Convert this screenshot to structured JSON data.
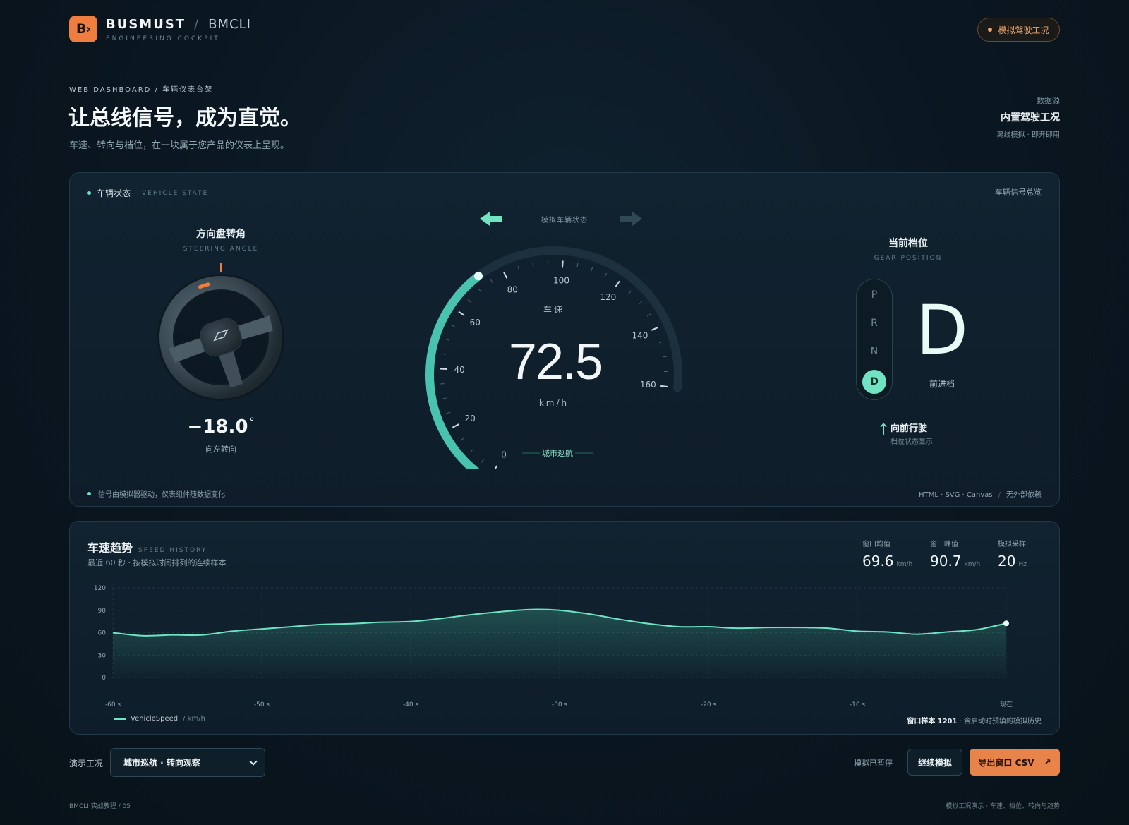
{
  "brand": {
    "logo": "B›",
    "name": "BUSMUST",
    "separator": "/",
    "product": "BMCLI",
    "tagline": "ENGINEERING COCKPIT"
  },
  "status_pill": "模拟驾驶工况",
  "hero": {
    "crumb": "WEB DASHBOARD / 车辆仪表台架",
    "title": "让总线信号，成为直觉。",
    "subtitle": "车速、转向与档位，在一块属于您产品的仪表上呈现。"
  },
  "source": {
    "label": "数据源",
    "value": "内置驾驶工况",
    "note": "离线模拟 · 即开即用"
  },
  "vehicle_panel": {
    "title": "车辆状态",
    "title_en": "VEHICLE STATE",
    "overview": "车辆信号总览",
    "turn_label": "模拟车辆状态",
    "footer_left": "信号由模拟器驱动，仪表组件随数据变化",
    "footer_tech": "HTML · SVG · Canvas",
    "footer_sep": "/",
    "footer_deps": "无外部依赖"
  },
  "steering": {
    "title": "方向盘转角",
    "title_en": "STEERING ANGLE",
    "value": "−18.0",
    "unit": "°",
    "direction": "向左转向",
    "angle": -18
  },
  "speedometer": {
    "label": "车速",
    "value": "72.5",
    "unit": "km/h",
    "mode": "城市巡航",
    "speed": 72.5,
    "max": 160,
    "ticks": [
      "0",
      "20",
      "40",
      "60",
      "80",
      "100",
      "120",
      "140",
      "160"
    ],
    "accent": "#6fe3c2"
  },
  "gear": {
    "title": "当前档位",
    "title_en": "GEAR POSITION",
    "options": [
      "P",
      "R",
      "N",
      "D"
    ],
    "selected": "D",
    "selected_label": "前进档",
    "direction_title": "向前行驶",
    "direction_sub": "档位状态显示"
  },
  "trend": {
    "title": "车速趋势",
    "title_en": "SPEED HISTORY",
    "subtitle": "最近 60 秒 · 按模拟时间排列的连续样本",
    "stats": [
      {
        "label": "窗口均值",
        "value": "69.6",
        "unit": "km/h"
      },
      {
        "label": "窗口峰值",
        "value": "90.7",
        "unit": "km/h"
      },
      {
        "label": "模拟采样",
        "value": "20",
        "unit": "Hz"
      }
    ],
    "legend_name": "VehicleSpeed",
    "legend_unit": "/ km/h",
    "window_note_label": "窗口样本",
    "window_note_count": "1201",
    "window_note_rest": "· 含启动时预填的模拟历史"
  },
  "chart_data": {
    "type": "area",
    "xlabel": "",
    "ylabel": "",
    "x_tick_labels": [
      "-60 s",
      "-50 s",
      "-40 s",
      "-30 s",
      "-20 s",
      "-10 s",
      "现在"
    ],
    "y_tick_labels": [
      "0",
      "30",
      "60",
      "90",
      "120"
    ],
    "ylim": [
      0,
      120
    ],
    "xlim": [
      -60,
      0
    ],
    "grid": true,
    "series": [
      {
        "name": "VehicleSpeed",
        "x": [
          -60,
          -58,
          -56,
          -54,
          -52,
          -50,
          -48,
          -46,
          -44,
          -42,
          -40,
          -38,
          -36,
          -34,
          -32,
          -30,
          -28,
          -26,
          -24,
          -22,
          -20,
          -18,
          -16,
          -14,
          -12,
          -10,
          -8,
          -6,
          -4,
          -2,
          0
        ],
        "values": [
          60,
          56,
          57,
          57,
          62,
          65,
          68,
          71,
          72,
          74,
          75,
          79,
          84,
          88,
          91,
          90,
          85,
          78,
          72,
          68,
          68,
          66,
          67,
          67,
          66,
          62,
          61,
          58,
          61,
          64,
          72.5
        ]
      }
    ]
  },
  "controls": {
    "scenario_label": "演示工况",
    "scenario_value": "城市巡航 · 转向观察",
    "state": "模拟已暂停",
    "continue": "继续模拟",
    "export": "导出窗口 CSV",
    "export_icon": "↗"
  },
  "footer": {
    "left": "BMCLI 实战教程 / 05",
    "right": "模拟工况演示 · 车速、档位、转向与趋势"
  }
}
